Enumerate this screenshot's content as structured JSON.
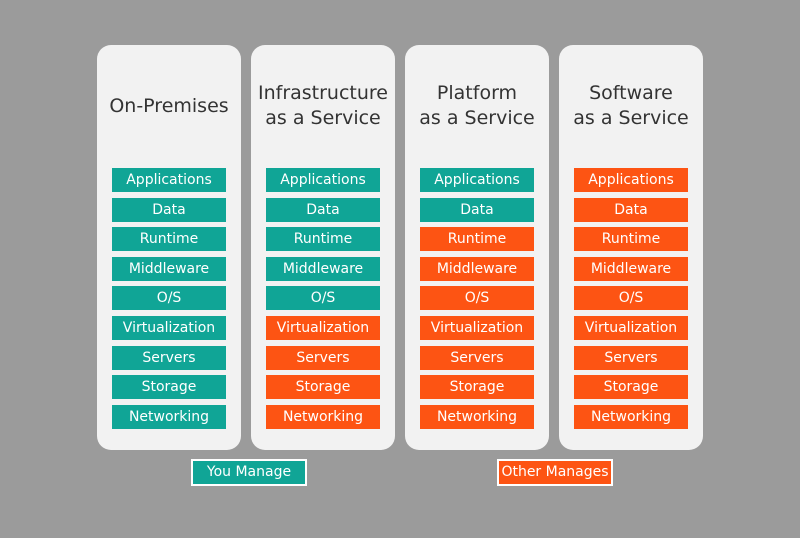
{
  "colors": {
    "you_manage": "#10a596",
    "other_manages": "#fd5413",
    "background": "#9b9b9b",
    "card": "#f2f2f2"
  },
  "layer_names": [
    "Applications",
    "Data",
    "Runtime",
    "Middleware",
    "O/S",
    "Virtualization",
    "Servers",
    "Storage",
    "Networking"
  ],
  "columns": [
    {
      "title_lines": [
        "On-Premises"
      ],
      "managed_by": [
        "you",
        "you",
        "you",
        "you",
        "you",
        "you",
        "you",
        "you",
        "you"
      ]
    },
    {
      "title_lines": [
        "Infrastructure",
        "as a Service"
      ],
      "managed_by": [
        "you",
        "you",
        "you",
        "you",
        "you",
        "other",
        "other",
        "other",
        "other"
      ]
    },
    {
      "title_lines": [
        "Platform",
        "as a Service"
      ],
      "managed_by": [
        "you",
        "you",
        "other",
        "other",
        "other",
        "other",
        "other",
        "other",
        "other"
      ]
    },
    {
      "title_lines": [
        "Software",
        "as a Service"
      ],
      "managed_by": [
        "other",
        "other",
        "other",
        "other",
        "other",
        "other",
        "other",
        "other",
        "other"
      ]
    }
  ],
  "legend": {
    "you_label": "You Manage",
    "other_label": "Other Manages"
  }
}
